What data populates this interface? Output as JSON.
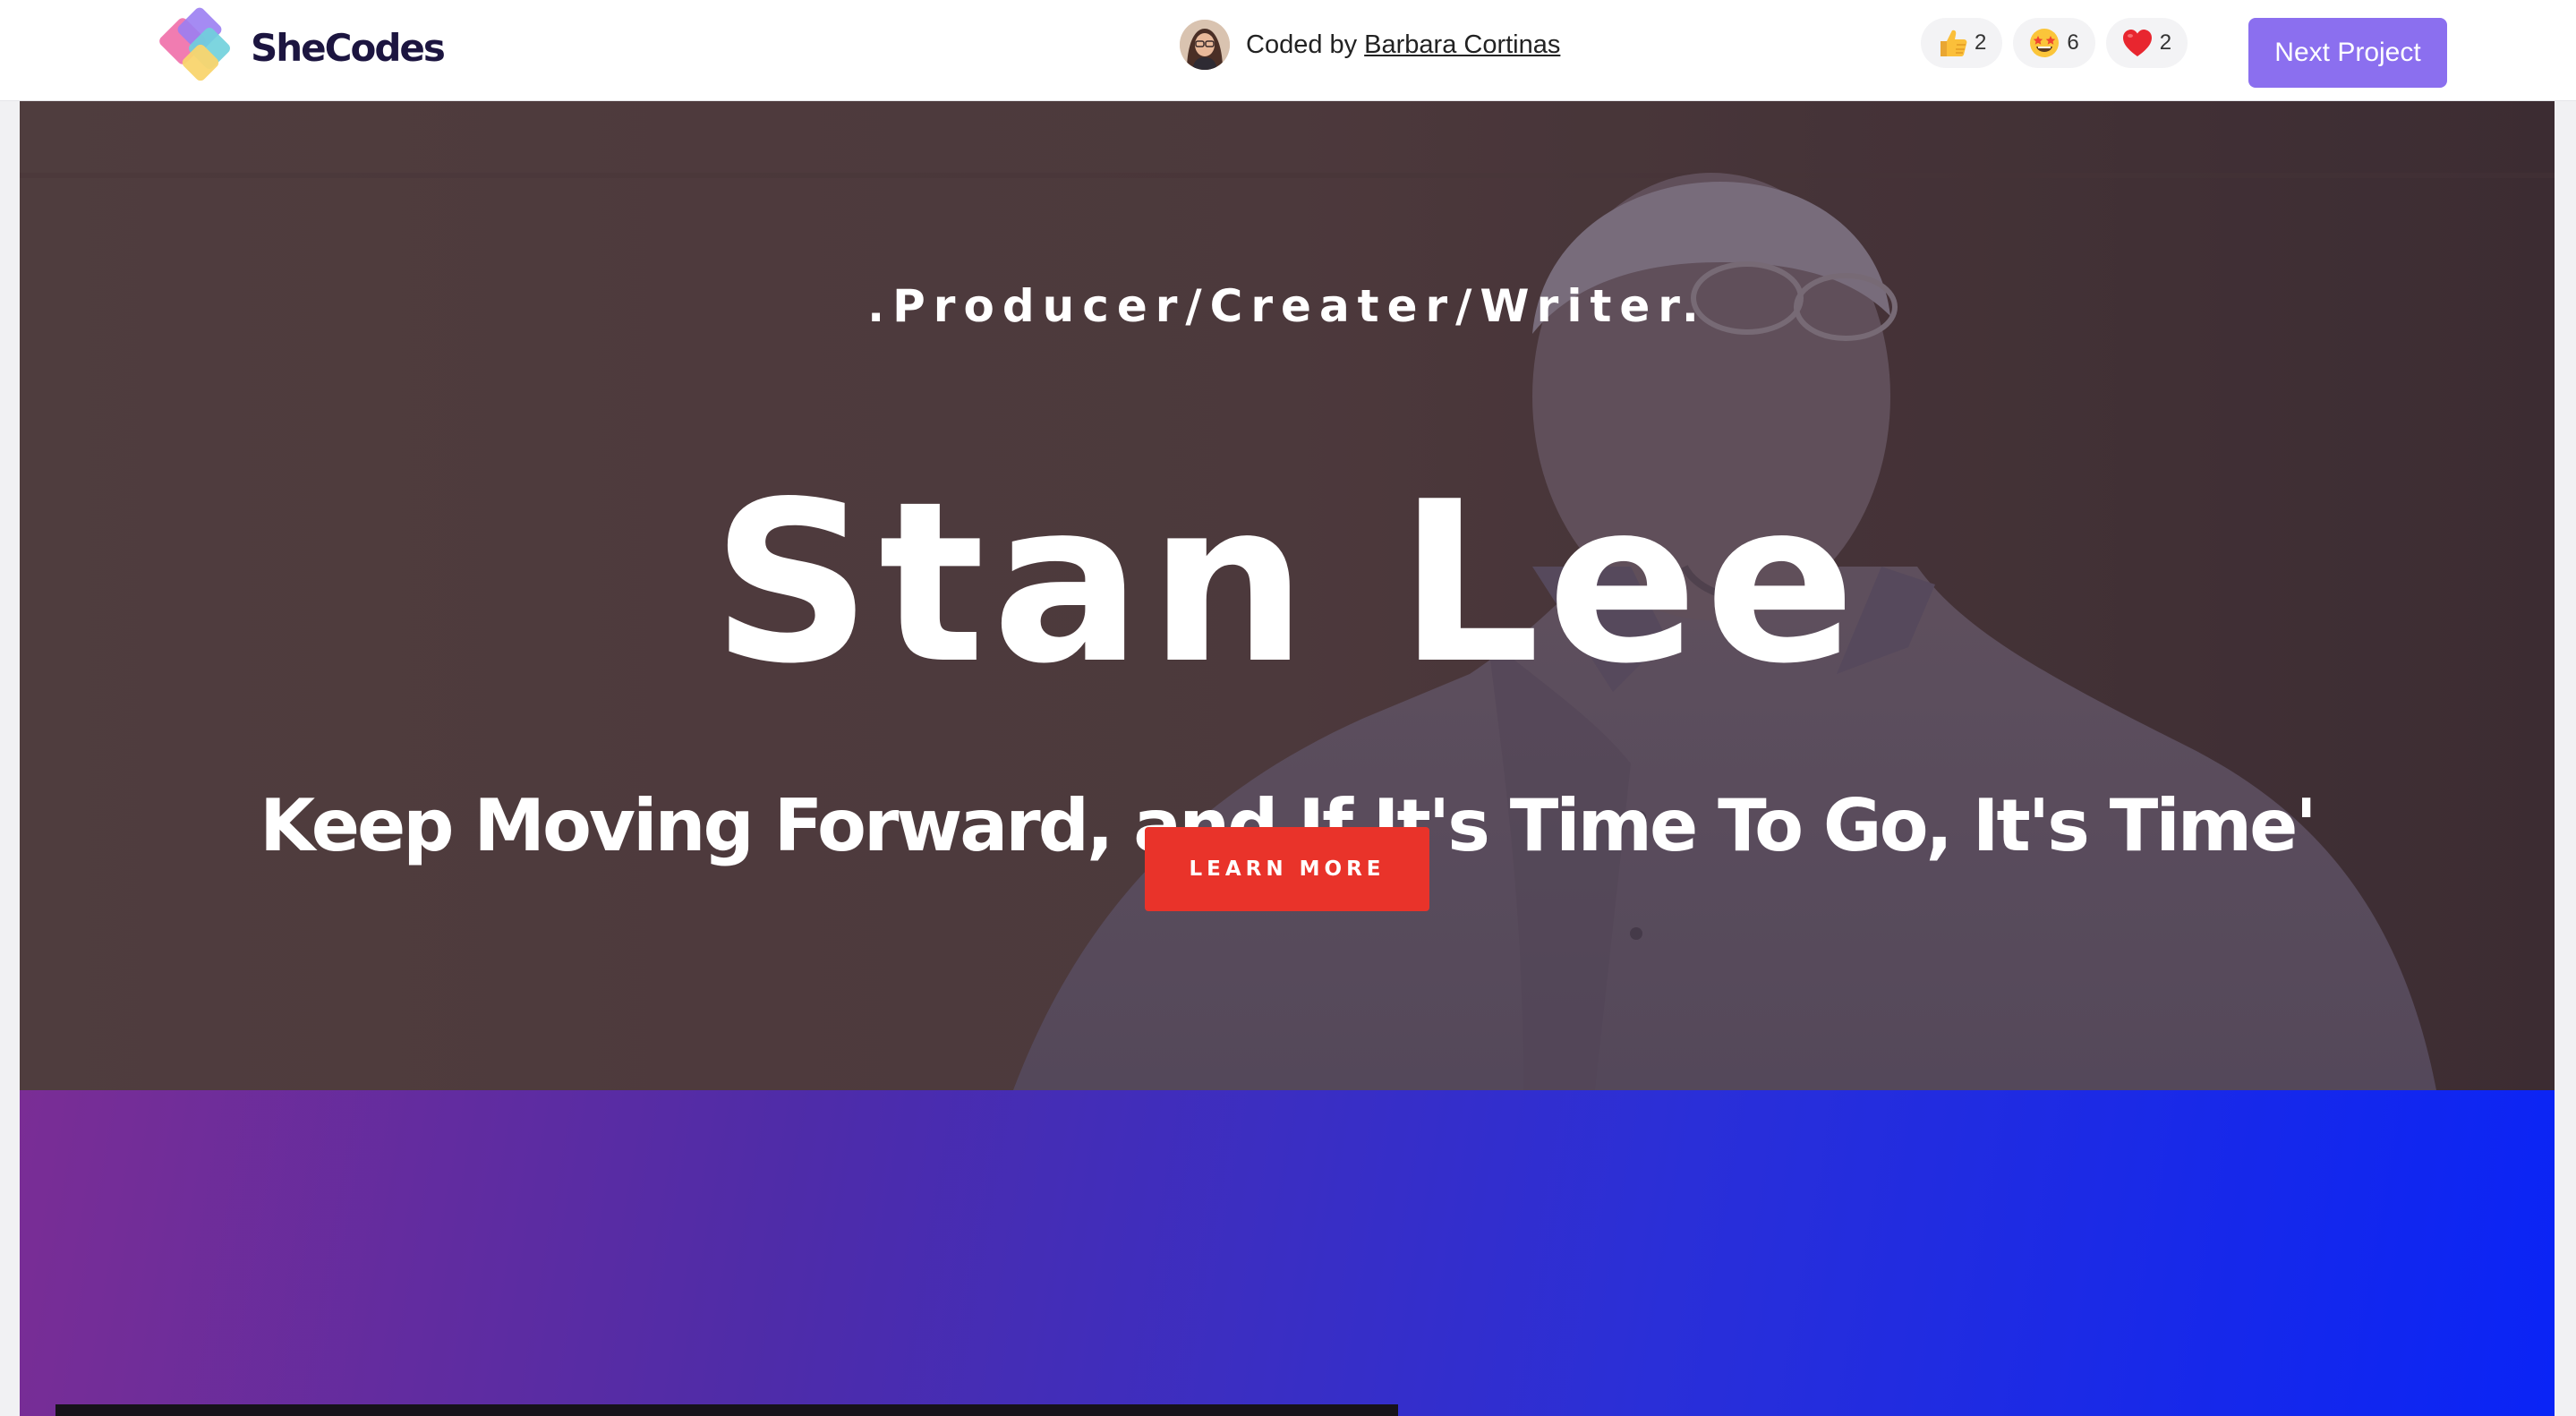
{
  "header": {
    "brand": "SheCodes",
    "credit_prefix": "Coded by",
    "credit_author": "Barbara Cortinas",
    "reactions": [
      {
        "icon": "thumbs-up-icon",
        "count": "2"
      },
      {
        "icon": "star-struck-icon",
        "count": "6"
      },
      {
        "icon": "heart-icon",
        "count": "2"
      }
    ],
    "next_label": "Next Project"
  },
  "hero": {
    "kicker": ".Producer/Creater/Writer.",
    "title": "Stan Lee",
    "quote": "Keep Moving Forward, and If It's Time To Go, It's Time'",
    "cta_label": "LEARN MORE"
  },
  "colors": {
    "accent_purple": "#8b6fef",
    "cta_red": "#e9332a",
    "gradient_start": "#7a2d95",
    "gradient_end": "#0a24f6",
    "brand_dark": "#1c1540"
  }
}
